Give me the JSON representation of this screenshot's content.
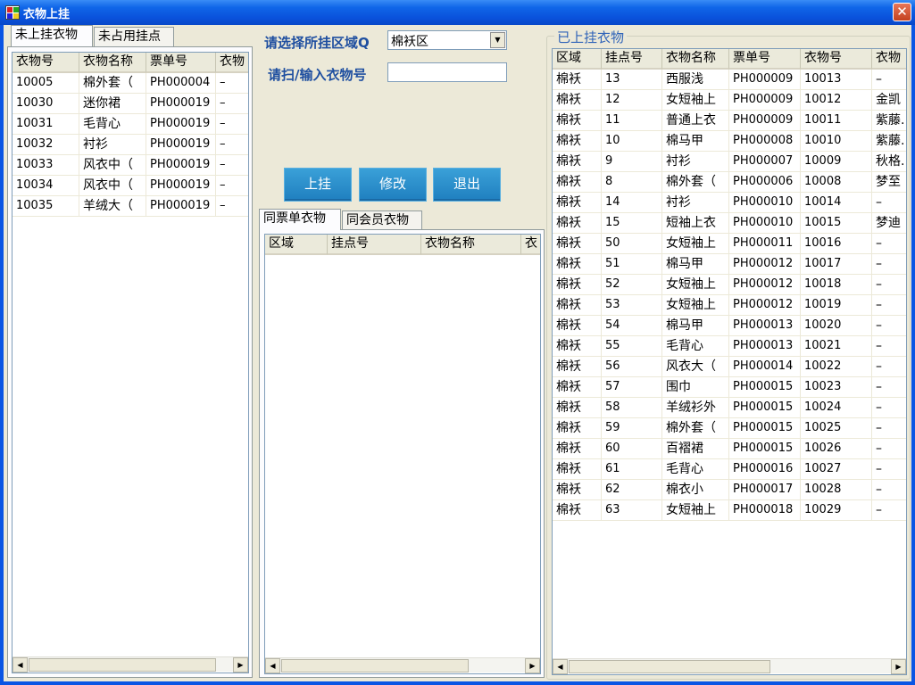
{
  "window": {
    "title": "衣物上挂",
    "icon": "app-icon",
    "close_icon": "close-icon"
  },
  "left": {
    "tabs": [
      "未上挂衣物",
      "未占用挂点"
    ],
    "columns": [
      "衣物号",
      "衣物名称",
      "票单号",
      "衣物"
    ],
    "rows": [
      [
        "10005",
        "棉外套（",
        "PH000004",
        "–"
      ],
      [
        "10030",
        "迷你裙",
        "PH000019",
        "–"
      ],
      [
        "10031",
        "毛背心",
        "PH000019",
        "–"
      ],
      [
        "10032",
        "衬衫",
        "PH000019",
        "–"
      ],
      [
        "10033",
        "风衣中（",
        "PH000019",
        "–"
      ],
      [
        "10034",
        "风衣中（",
        "PH000019",
        "–"
      ],
      [
        "10035",
        "羊绒大（",
        "PH000019",
        "–"
      ]
    ]
  },
  "middle": {
    "area_label": "请选择所挂区域Q",
    "area_value": "棉袄区",
    "scan_label": "请扫/输入衣物号",
    "scan_value": "",
    "buttons": {
      "hang": "上挂",
      "edit": "修改",
      "exit": "退出"
    },
    "tabs": [
      "同票单衣物",
      "同会员衣物"
    ],
    "columns": [
      "区域",
      "挂点号",
      "衣物名称",
      "衣"
    ]
  },
  "right": {
    "group_title": "已上挂衣物",
    "columns": [
      "区域",
      "挂点号",
      "衣物名称",
      "票单号",
      "衣物号",
      "衣物"
    ],
    "rows": [
      [
        "棉袄",
        "13",
        "西服浅",
        "PH000009",
        "10013",
        "–"
      ],
      [
        "棉袄",
        "12",
        "女短袖上",
        "PH000009",
        "10012",
        "金凯"
      ],
      [
        "棉袄",
        "11",
        "普通上衣",
        "PH000009",
        "10011",
        "紫藤."
      ],
      [
        "棉袄",
        "10",
        "棉马甲",
        "PH000008",
        "10010",
        "紫藤."
      ],
      [
        "棉袄",
        "9",
        "衬衫",
        "PH000007",
        "10009",
        "秋格."
      ],
      [
        "棉袄",
        "8",
        "棉外套（",
        "PH000006",
        "10008",
        "梦至"
      ],
      [
        "棉袄",
        "14",
        "衬衫",
        "PH000010",
        "10014",
        "–"
      ],
      [
        "棉袄",
        "15",
        "短袖上衣",
        "PH000010",
        "10015",
        "梦迪"
      ],
      [
        "棉袄",
        "50",
        "女短袖上",
        "PH000011",
        "10016",
        "–"
      ],
      [
        "棉袄",
        "51",
        "棉马甲",
        "PH000012",
        "10017",
        "–"
      ],
      [
        "棉袄",
        "52",
        "女短袖上",
        "PH000012",
        "10018",
        "–"
      ],
      [
        "棉袄",
        "53",
        "女短袖上",
        "PH000012",
        "10019",
        "–"
      ],
      [
        "棉袄",
        "54",
        "棉马甲",
        "PH000013",
        "10020",
        "–"
      ],
      [
        "棉袄",
        "55",
        "毛背心",
        "PH000013",
        "10021",
        "–"
      ],
      [
        "棉袄",
        "56",
        "风衣大（",
        "PH000014",
        "10022",
        "–"
      ],
      [
        "棉袄",
        "57",
        "围巾",
        "PH000015",
        "10023",
        "–"
      ],
      [
        "棉袄",
        "58",
        "羊绒衫外",
        "PH000015",
        "10024",
        "–"
      ],
      [
        "棉袄",
        "59",
        "棉外套（",
        "PH000015",
        "10025",
        "–"
      ],
      [
        "棉袄",
        "60",
        "百褶裙",
        "PH000015",
        "10026",
        "–"
      ],
      [
        "棉袄",
        "61",
        "毛背心",
        "PH000016",
        "10027",
        "–"
      ],
      [
        "棉袄",
        "62",
        "棉衣小",
        "PH000017",
        "10028",
        "–"
      ],
      [
        "棉袄",
        "63",
        "女短袖上",
        "PH000018",
        "10029",
        "–"
      ]
    ]
  }
}
